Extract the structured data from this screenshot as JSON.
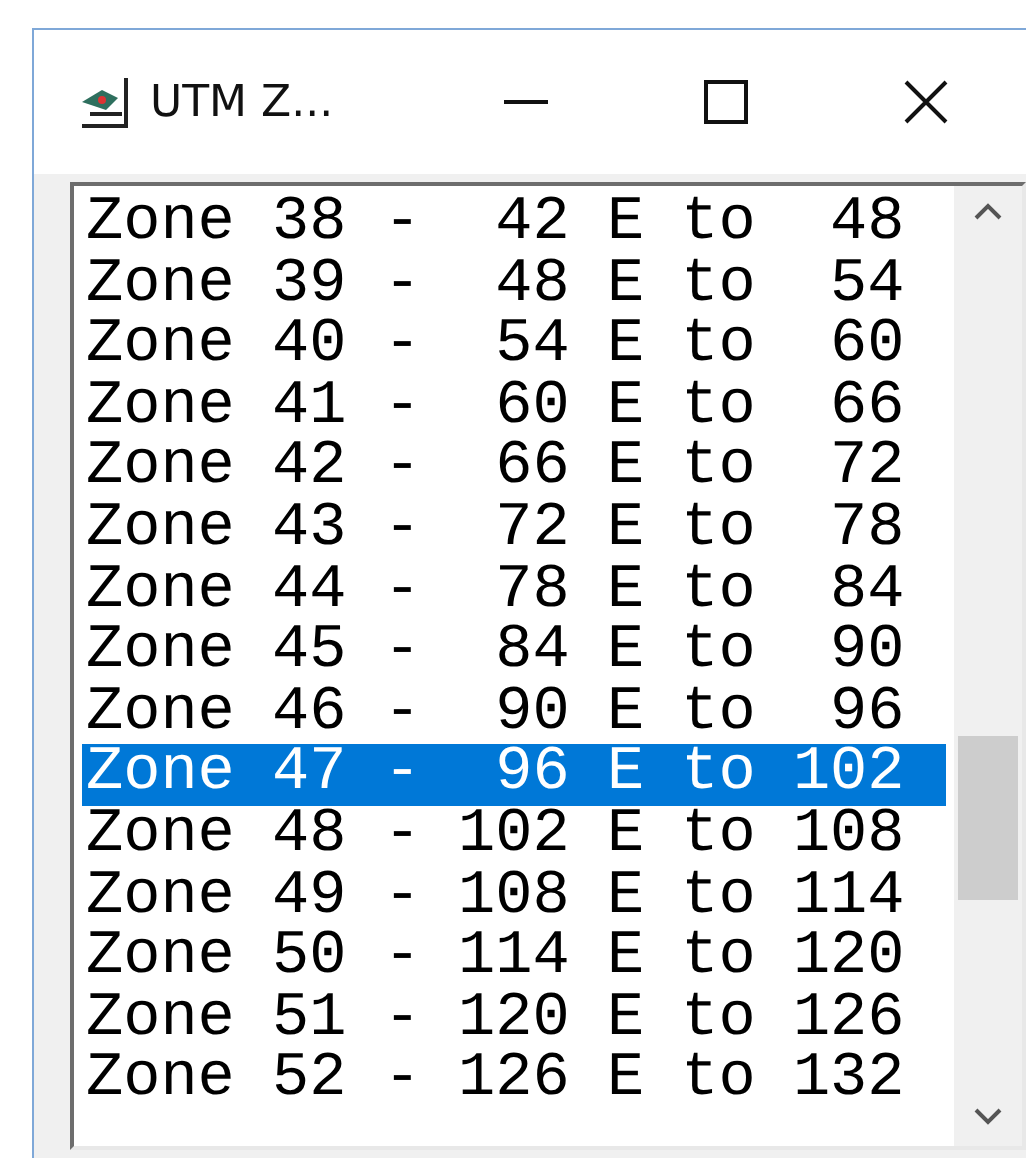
{
  "window": {
    "title": "UTM Z..."
  },
  "list": {
    "items": [
      {
        "text": "Zone 38 -  42 E to  48",
        "selected": false
      },
      {
        "text": "Zone 39 -  48 E to  54",
        "selected": false
      },
      {
        "text": "Zone 40 -  54 E to  60",
        "selected": false
      },
      {
        "text": "Zone 41 -  60 E to  66",
        "selected": false
      },
      {
        "text": "Zone 42 -  66 E to  72",
        "selected": false
      },
      {
        "text": "Zone 43 -  72 E to  78",
        "selected": false
      },
      {
        "text": "Zone 44 -  78 E to  84",
        "selected": false
      },
      {
        "text": "Zone 45 -  84 E to  90",
        "selected": false
      },
      {
        "text": "Zone 46 -  90 E to  96",
        "selected": false
      },
      {
        "text": "Zone 47 -  96 E to 102",
        "selected": true
      },
      {
        "text": "Zone 48 - 102 E to 108",
        "selected": false
      },
      {
        "text": "Zone 49 - 108 E to 114",
        "selected": false
      },
      {
        "text": "Zone 50 - 114 E to 120",
        "selected": false
      },
      {
        "text": "Zone 51 - 120 E to 126",
        "selected": false
      },
      {
        "text": "Zone 52 - 126 E to 132",
        "selected": false
      }
    ]
  }
}
